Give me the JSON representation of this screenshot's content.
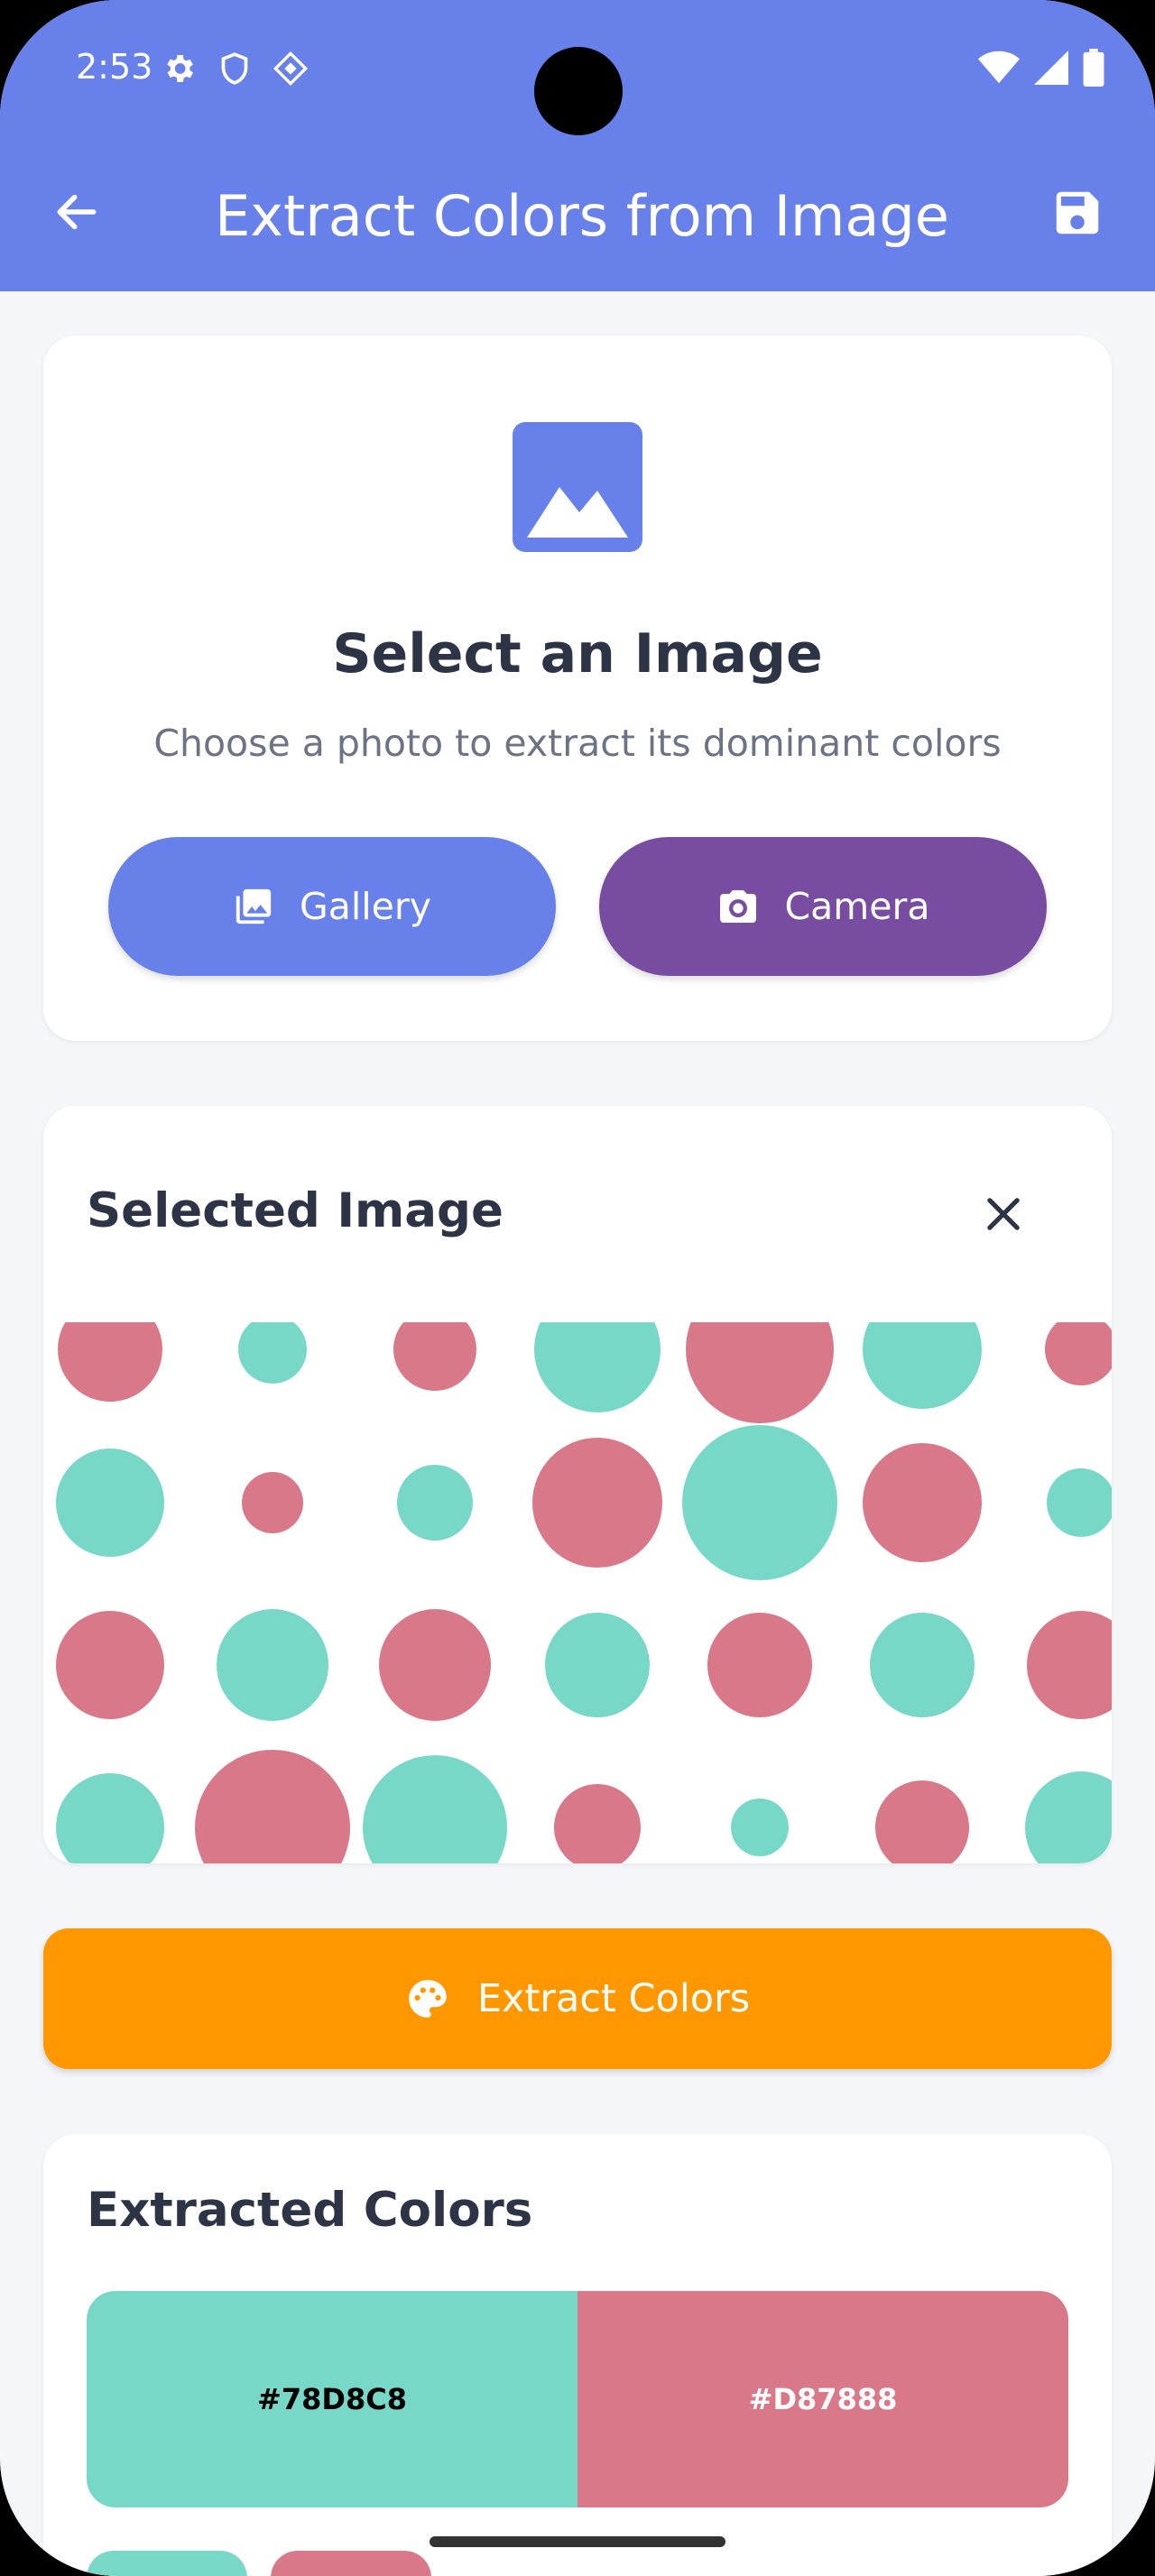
{
  "status_bar": {
    "time": "2:53"
  },
  "app_bar": {
    "title": "Extract Colors from Image"
  },
  "select_card": {
    "title": "Select an Image",
    "subtitle": "Choose a photo to extract its dominant colors",
    "gallery_label": "Gallery",
    "camera_label": "Camera"
  },
  "selected_card": {
    "title": "Selected Image"
  },
  "extract_button": {
    "label": "Extract Colors"
  },
  "extracted_card": {
    "title": "Extracted Colors",
    "colors": [
      {
        "hex": "#78D8C8",
        "label": "#78D8C8",
        "text_color": "#000000"
      },
      {
        "hex": "#D87888",
        "label": "#D87888",
        "text_color": "#ffffff"
      }
    ]
  },
  "colors": {
    "primary": "#6780ea",
    "camera": "#774ca1",
    "accent": "#ff9800",
    "dot_teal": "#78D8C8",
    "dot_pink": "#D87888"
  }
}
